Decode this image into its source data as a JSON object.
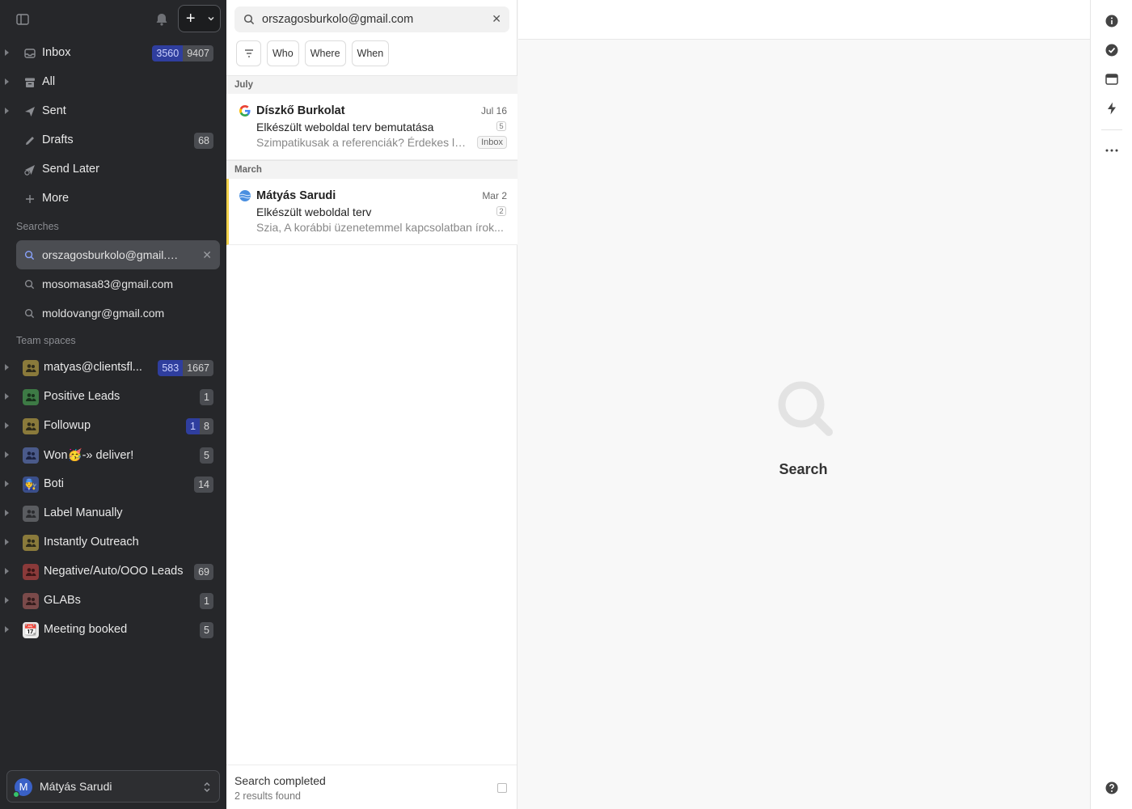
{
  "sidebar": {
    "nav": [
      {
        "label": "Inbox",
        "icon": "inbox-icon",
        "unread": "3560",
        "total": "9407"
      },
      {
        "label": "All",
        "icon": "archive-icon"
      },
      {
        "label": "Sent",
        "icon": "send-icon"
      },
      {
        "label": "Drafts",
        "icon": "pencil-icon",
        "total": "68"
      },
      {
        "label": "Send Later",
        "icon": "send-later-icon"
      },
      {
        "label": "More",
        "icon": "plus-icon"
      }
    ],
    "searches_heading": "Searches",
    "searches": [
      {
        "label": "orszagosburkolo@gmail.com",
        "active": true
      },
      {
        "label": "mosomasa83@gmail.com"
      },
      {
        "label": "moldovangr@gmail.com"
      }
    ],
    "team_heading": "Team spaces",
    "teams": [
      {
        "label": "matyas@clientsfl...",
        "unread": "583",
        "total": "1667",
        "color": "#8a7a3b"
      },
      {
        "label": "Positive Leads",
        "total": "1",
        "color": "#3d7a45"
      },
      {
        "label": "Followup",
        "unread": "1",
        "total": "8",
        "color": "#8a7a3b"
      },
      {
        "label": "Won🥳-» deliver!",
        "total": "5",
        "color": "#4a5a8a"
      },
      {
        "label": "Boti",
        "total": "14",
        "emoji": "👨‍🔧"
      },
      {
        "label": "Label Manually",
        "color": "#5a5c60"
      },
      {
        "label": "Instantly Outreach",
        "color": "#8a7a3b"
      },
      {
        "label": "Negative/Auto/OOO Leads",
        "total": "69",
        "color": "#8a3a3a"
      },
      {
        "label": "GLABs",
        "total": "1",
        "color": "#7a4a4a"
      },
      {
        "label": "Meeting booked",
        "total": "5",
        "emoji": "📆"
      }
    ],
    "user": {
      "initial": "M",
      "name": "Mátyás Sarudi"
    }
  },
  "list": {
    "search_value": "orszagosburkolo@gmail.com",
    "filters": [
      "Who",
      "Where",
      "When"
    ],
    "groups": [
      {
        "label": "July",
        "mails": [
          {
            "from": "Díszkő Burkolat",
            "date": "Jul 16",
            "subject": "Elkészült weboldal terv bemutatása",
            "count": "5",
            "preview": "Szimpatikusak a referenciák? Érdekes lenne",
            "badge": "Inbox"
          }
        ]
      },
      {
        "label": "March",
        "mails": [
          {
            "from": "Mátyás Sarudi",
            "date": "Mar 2",
            "subject": "Elkészült weboldal terv",
            "count": "2",
            "preview": "Szia, A korábbi üzenetemmel kapcsolatban írok..."
          }
        ]
      }
    ],
    "status": {
      "title": "Search completed",
      "subtitle": "2 results found"
    }
  },
  "pane": {
    "title": "Search"
  },
  "colors": {
    "sidebar_bg": "#26272a",
    "unread_badge": "#2f3e9e",
    "selected_accent": "#f2d24a"
  }
}
